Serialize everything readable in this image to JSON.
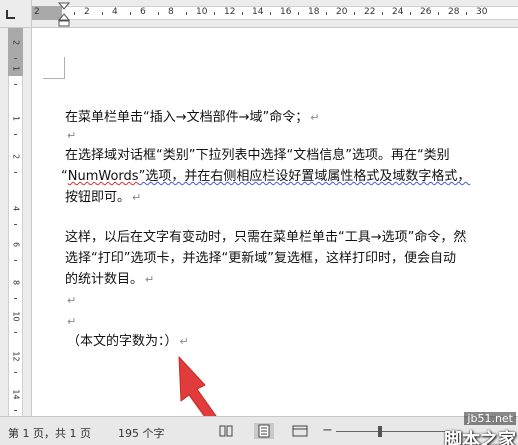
{
  "ruler": {
    "h_labels": [
      "2",
      "2",
      "4",
      "6",
      "8",
      "10",
      "12",
      "14",
      "16",
      "18",
      "20",
      "22",
      "24",
      "26",
      "28",
      "30"
    ],
    "v_labels": [
      "2",
      "1",
      "1",
      "2",
      "4",
      "6",
      "8",
      "10",
      "12",
      "14"
    ]
  },
  "document": {
    "paragraph_mark": "↵",
    "paragraphs": [
      "在菜单栏单击“插入→文档部件→域”命令；",
      "",
      "在选择域对话框“类别”下拉列表中选择“文档信息”选项。再在“类别",
      "“NumWords”选项，并在右侧相应栏设好置域属性格式及域数字格式，",
      "按钮即可。",
      "",
      "这样，以后在文字有变动时，只需在菜单栏单击“工具→选项”命令，然",
      "选择“打印”选项卡，并选择“更新域”复选框，这样打印时，便会自动",
      "的统计数目。",
      "",
      "",
      "（本文的字数为：）"
    ],
    "numwords_prefix": "“",
    "numwords_word": "NumWords",
    "line4_rest": "”选项，并在右侧相应栏设好置域属性格式及域数字格式，"
  },
  "status_bar": {
    "page_info": "第 1 页，共 1 页",
    "word_count": "195 个字"
  },
  "watermark": {
    "url": "jb51.net",
    "brand": "脚本之家"
  },
  "colors": {
    "ruler_bg": "#ececec",
    "margin_gray": "#a9a9a9",
    "arrow_red": "#e23b3b",
    "status_bg": "#e8e8e8"
  },
  "icons": {
    "tab_stop": "tab-stop-icon",
    "indent": "indent-marker-icon",
    "arrow": "red-arrow-icon",
    "read_mode": "read-mode-icon",
    "print_layout": "print-layout-icon",
    "web_layout": "web-layout-icon"
  }
}
